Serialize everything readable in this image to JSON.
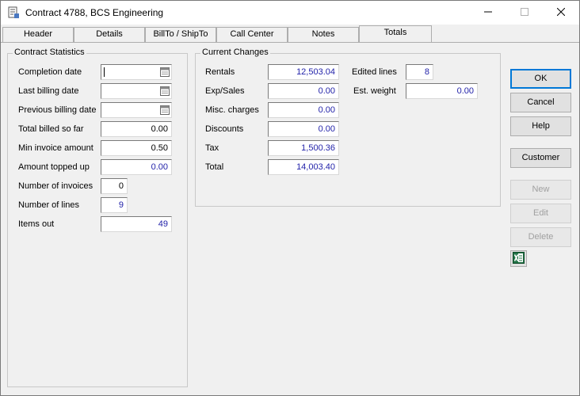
{
  "window": {
    "title": "Contract 4788, BCS Engineering"
  },
  "tabs": [
    {
      "label": "Header"
    },
    {
      "label": "Details"
    },
    {
      "label": "BillTo / ShipTo"
    },
    {
      "label": "Call Center"
    },
    {
      "label": "Notes"
    },
    {
      "label": "Totals"
    }
  ],
  "active_tab": "Totals",
  "contract_statistics": {
    "title": "Contract Statistics",
    "completion_date_label": "Completion date",
    "completion_date_value": "",
    "last_billing_date_label": "Last billing date",
    "last_billing_date_value": "",
    "previous_billing_date_label": "Previous billing date",
    "previous_billing_date_value": "",
    "total_billed_label": "Total billed so far",
    "total_billed_value": "0.00",
    "min_invoice_label": "Min invoice amount",
    "min_invoice_value": "0.50",
    "amount_topped_label": "Amount topped up",
    "amount_topped_value": "0.00",
    "num_invoices_label": "Number of invoices",
    "num_invoices_value": "0",
    "num_lines_label": "Number of lines",
    "num_lines_value": "9",
    "items_out_label": "Items out",
    "items_out_value": "49"
  },
  "current_changes": {
    "title": "Current Changes",
    "rentals_label": "Rentals",
    "rentals_value": "12,503.04",
    "exp_sales_label": "Exp/Sales",
    "exp_sales_value": "0.00",
    "misc_label": "Misc. charges",
    "misc_value": "0.00",
    "discounts_label": "Discounts",
    "discounts_value": "0.00",
    "tax_label": "Tax",
    "tax_value": "1,500.36",
    "total_label": "Total",
    "total_value": "14,003.40",
    "edited_lines_label": "Edited lines",
    "edited_lines_value": "8",
    "est_weight_label": "Est. weight",
    "est_weight_value": "0.00"
  },
  "buttons": {
    "ok": "OK",
    "cancel": "Cancel",
    "help": "Help",
    "customer": "Customer",
    "new": "New",
    "edit": "Edit",
    "delete": "Delete"
  },
  "icons": {
    "app": "document-icon",
    "calendar": "calendar-icon",
    "excel": "excel-icon"
  },
  "colors": {
    "value_blue": "#1f1fa8",
    "accent": "#0078d7",
    "excel_green": "#217346"
  }
}
